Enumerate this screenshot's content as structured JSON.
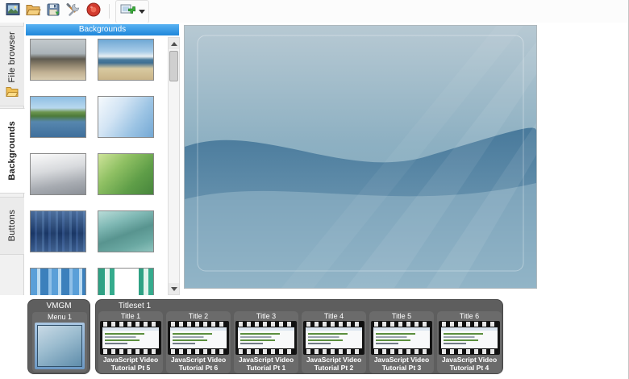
{
  "toolbar": {
    "buttons": [
      {
        "icon": "new-project-icon"
      },
      {
        "icon": "open-project-icon"
      },
      {
        "icon": "save-project-icon"
      },
      {
        "icon": "settings-wrench-icon"
      },
      {
        "icon": "burn-disc-icon"
      },
      {
        "icon": "add-menu-object-icon"
      }
    ]
  },
  "sidebar": {
    "tabs": [
      {
        "label": "File browser",
        "selected": false,
        "icon": "folder-icon"
      },
      {
        "label": "Backgrounds",
        "selected": true
      },
      {
        "label": "Buttons",
        "selected": false
      }
    ]
  },
  "backgrounds_panel": {
    "header": "Backgrounds",
    "thumbnails": [
      {
        "name": "rocky-coast-photo"
      },
      {
        "name": "beach-coast-photo"
      },
      {
        "name": "lake-landscape-photo"
      },
      {
        "name": "blue-sky-gradient"
      },
      {
        "name": "gray-gradient"
      },
      {
        "name": "green-gradient"
      },
      {
        "name": "blue-striped-abstract"
      },
      {
        "name": "teal-mist-abstract"
      },
      {
        "name": "blue-bands-abstract"
      },
      {
        "name": "green-bands-abstract"
      }
    ]
  },
  "canvas": {
    "background_name": "blue-wave-menu-background"
  },
  "bottom": {
    "vmgm": {
      "group_label": "VMGM",
      "items": [
        {
          "label": "Menu 1",
          "selected": true
        }
      ]
    },
    "titleset": {
      "group_label": "Titleset 1",
      "titles": [
        {
          "label": "Title 1",
          "caption": "JavaScript Video Tutorial Pt 5"
        },
        {
          "label": "Title 2",
          "caption": "JavaScript Video Tutorial Pt 6"
        },
        {
          "label": "Title 3",
          "caption": "JavaScript Video Tutorial Pt 1"
        },
        {
          "label": "Title 4",
          "caption": "JavaScript Video Tutorial Pt 2"
        },
        {
          "label": "Title 5",
          "caption": "JavaScript Video Tutorial Pt 3"
        },
        {
          "label": "Title 6",
          "caption": "JavaScript Video Tutorial Pt 4"
        }
      ]
    }
  },
  "colors": {
    "header_blue": "#2b99ea",
    "group_gray": "#5e5e5e",
    "selection_blue": "#7fa9d0"
  }
}
